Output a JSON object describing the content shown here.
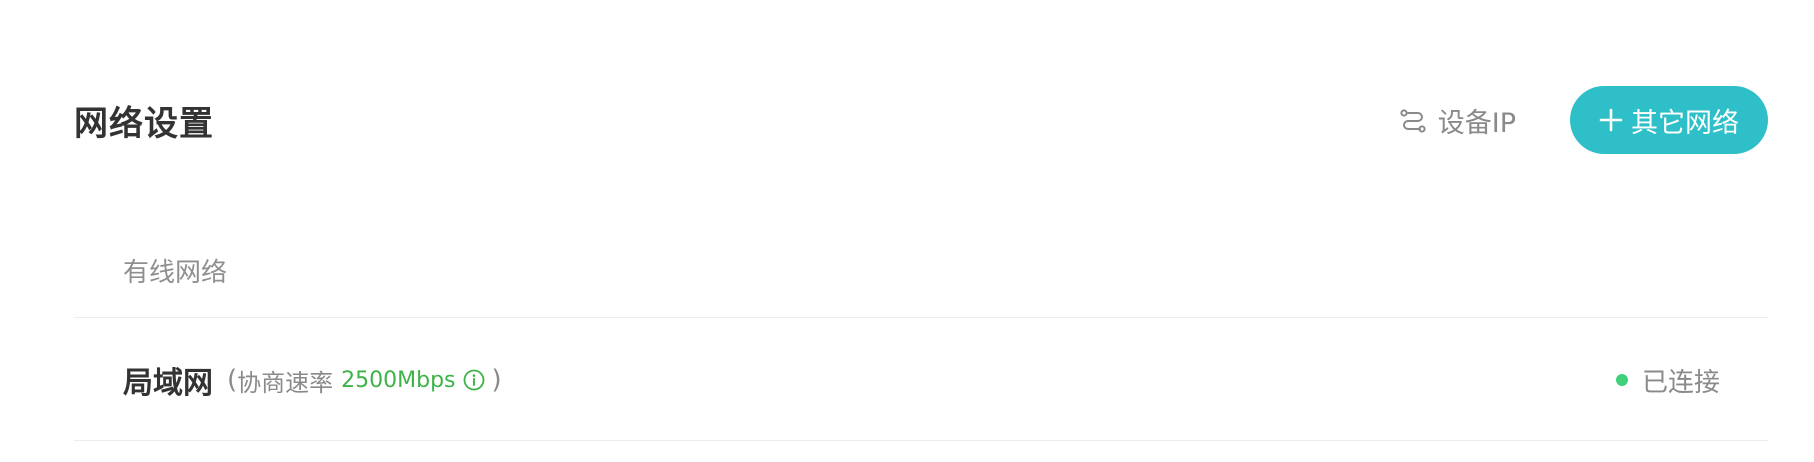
{
  "header": {
    "title": "网络设置",
    "device_ip_label": "设备IP",
    "device_ip_icon": "network-switch-icon",
    "other_network_label": "其它网络",
    "other_network_icon": "plus-icon"
  },
  "section": {
    "wired_label": "有线网络"
  },
  "lan_row": {
    "name": "局域网",
    "paren_open": "(",
    "rate_label": "协商速率",
    "rate_value": "2500Mbps",
    "info_icon": "info-icon",
    "paren_close": ")",
    "status_label": "已连接"
  },
  "colors": {
    "accent": "#2fbfc8",
    "rate_green": "#3db34a",
    "status_connected": "#3fd07a"
  }
}
